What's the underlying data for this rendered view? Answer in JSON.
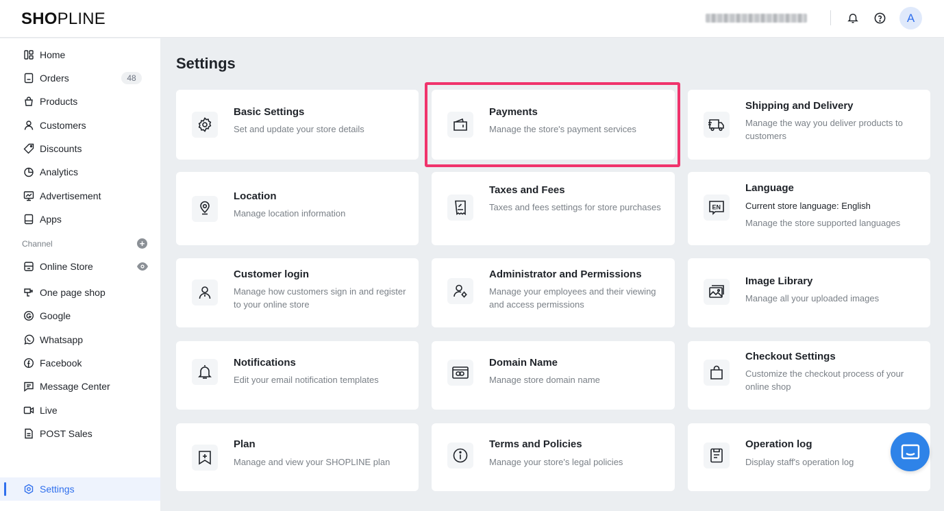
{
  "brand": {
    "logo_part1": "SH",
    "logo_part2": "O",
    "logo_part3": "P",
    "logo_part4": "LINE"
  },
  "header": {
    "avatar_letter": "A",
    "icons": [
      "bell-icon",
      "help-icon"
    ]
  },
  "sidebar": {
    "items": [
      {
        "label": "Home",
        "icon": "home-icon"
      },
      {
        "label": "Orders",
        "icon": "orders-icon",
        "badge": "48"
      },
      {
        "label": "Products",
        "icon": "products-icon"
      },
      {
        "label": "Customers",
        "icon": "customers-icon"
      },
      {
        "label": "Discounts",
        "icon": "discount-tag-icon"
      },
      {
        "label": "Analytics",
        "icon": "analytics-icon"
      },
      {
        "label": "Advertisement",
        "icon": "advertisement-icon"
      },
      {
        "label": "Apps",
        "icon": "apps-icon"
      }
    ],
    "channel_label": "Channel",
    "channels": [
      {
        "label": "Online Store",
        "icon": "online-store-icon"
      },
      {
        "label": "One page shop",
        "icon": "one-page-shop-icon"
      },
      {
        "label": "Google",
        "icon": "google-icon"
      },
      {
        "label": "Whatsapp",
        "icon": "whatsapp-icon"
      },
      {
        "label": "Facebook",
        "icon": "facebook-icon"
      },
      {
        "label": "Message Center",
        "icon": "message-center-icon"
      },
      {
        "label": "Live",
        "icon": "live-icon"
      },
      {
        "label": "POST Sales",
        "icon": "post-sales-icon"
      }
    ],
    "settings": {
      "label": "Settings",
      "icon": "settings-icon"
    }
  },
  "main": {
    "title": "Settings",
    "cards": [
      {
        "title": "Basic Settings",
        "desc": "Set and update your store details",
        "icon": "gear-icon"
      },
      {
        "title": "Payments",
        "desc": "Manage the store's payment services",
        "icon": "wallet-icon"
      },
      {
        "title": "Shipping and Delivery",
        "desc": "Manage the way you deliver products to customers",
        "icon": "truck-icon"
      },
      {
        "title": "Location",
        "desc": "Manage location information",
        "icon": "location-pin-icon"
      },
      {
        "title": "Taxes and Fees",
        "desc": "Taxes and fees settings for store purchases",
        "icon": "receipt-icon"
      },
      {
        "title": "Language",
        "desc": "Current store language: English",
        "desc2": "Manage the store supported languages",
        "icon": "language-en-icon"
      },
      {
        "title": "Customer login",
        "desc": "Manage how customers sign in and register to your online store",
        "icon": "user-icon"
      },
      {
        "title": "Administrator and Permissions",
        "desc": "Manage your employees and their viewing and access permissions",
        "icon": "admin-permissions-icon"
      },
      {
        "title": "Image Library",
        "desc": "Manage all your uploaded images",
        "icon": "image-library-icon"
      },
      {
        "title": "Notifications",
        "desc": "Edit your email notification templates",
        "icon": "bell-icon"
      },
      {
        "title": "Domain Name",
        "desc": "Manage store domain name",
        "icon": "domain-link-icon"
      },
      {
        "title": "Checkout Settings",
        "desc": "Customize the checkout process of your online shop",
        "icon": "shopping-bag-icon"
      },
      {
        "title": "Plan",
        "desc": "Manage and view your SHOPLINE plan",
        "icon": "plan-bookmark-icon"
      },
      {
        "title": "Terms and Policies",
        "desc": "Manage your store's legal policies",
        "icon": "info-icon"
      },
      {
        "title": "Operation log",
        "desc": "Display staff's operation log",
        "icon": "operation-log-icon"
      }
    ]
  },
  "colors": {
    "accent": "#2f6fed",
    "highlight": "#f0336c",
    "chat": "#2e83e8"
  }
}
